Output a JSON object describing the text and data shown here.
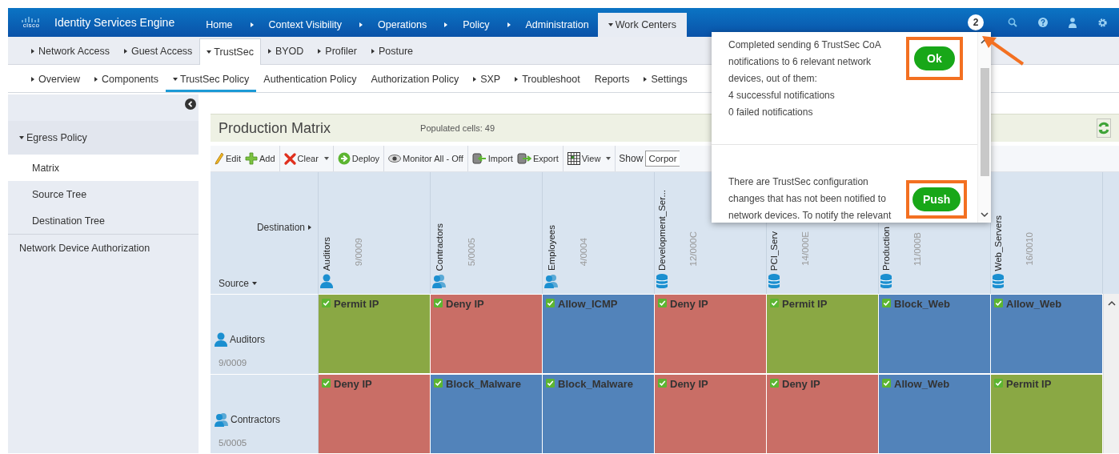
{
  "header": {
    "logo": "cisco",
    "product": "Identity Services Engine",
    "badge": "2",
    "nav": [
      {
        "label": "Home",
        "has_menu": false,
        "selected": false
      },
      {
        "label": "Context Visibility",
        "has_menu": true,
        "selected": false
      },
      {
        "label": "Operations",
        "has_menu": true,
        "selected": false
      },
      {
        "label": "Policy",
        "has_menu": true,
        "selected": false
      },
      {
        "label": "Administration",
        "has_menu": true,
        "selected": false
      },
      {
        "label": "Work Centers",
        "has_menu": true,
        "selected": true
      }
    ]
  },
  "subnav": [
    {
      "label": "Network Access",
      "has_menu": true,
      "selected": false
    },
    {
      "label": "Guest Access",
      "has_menu": true,
      "selected": false
    },
    {
      "label": "TrustSec",
      "has_menu": true,
      "selected": true
    },
    {
      "label": "BYOD",
      "has_menu": true,
      "selected": false
    },
    {
      "label": "Profiler",
      "has_menu": true,
      "selected": false
    },
    {
      "label": "Posture",
      "has_menu": true,
      "selected": false
    }
  ],
  "tabs": [
    {
      "label": "Overview",
      "has_menu": true,
      "selected": false
    },
    {
      "label": "Components",
      "has_menu": true,
      "selected": false
    },
    {
      "label": "TrustSec Policy",
      "has_menu": true,
      "selected": true
    },
    {
      "label": "Authentication Policy",
      "has_menu": false,
      "selected": false
    },
    {
      "label": "Authorization Policy",
      "has_menu": false,
      "selected": false
    },
    {
      "label": "SXP",
      "has_menu": true,
      "selected": false
    },
    {
      "label": "Troubleshoot",
      "has_menu": true,
      "selected": false
    },
    {
      "label": "Reports",
      "has_menu": false,
      "selected": false
    },
    {
      "label": "Settings",
      "has_menu": true,
      "selected": false
    }
  ],
  "sidebar": {
    "section": "Egress Policy",
    "expanded": true,
    "items": [
      {
        "label": "Matrix",
        "selected": true
      },
      {
        "label": "Source Tree",
        "selected": false
      },
      {
        "label": "Destination Tree",
        "selected": false
      }
    ],
    "other_items": [
      {
        "label": "Network Device Authorization",
        "selected": false
      }
    ]
  },
  "matrix": {
    "title": "Production Matrix",
    "populated": "Populated cells: 49",
    "toolbar": [
      [
        {
          "label": "Edit",
          "kind": "edit",
          "dropdown": false
        },
        {
          "label": "Add",
          "kind": "add",
          "dropdown": false
        }
      ],
      [
        {
          "label": "Clear",
          "kind": "clear",
          "dropdown": true
        }
      ],
      [
        {
          "label": "Deploy",
          "kind": "deploy",
          "dropdown": false
        }
      ],
      [
        {
          "label": "Monitor All - Off",
          "kind": "monitor",
          "dropdown": false
        }
      ],
      [
        {
          "label": "Import",
          "kind": "import",
          "dropdown": false
        },
        {
          "label": "Export",
          "kind": "export",
          "dropdown": false
        }
      ],
      [
        {
          "label": "View",
          "kind": "view",
          "dropdown": true
        }
      ]
    ],
    "show_label": "Show",
    "show_value": "Corpor",
    "destination_label": "Destination",
    "source_label": "Source",
    "columns": [
      {
        "name": "Auditors",
        "code": "9/0009",
        "kind": "user"
      },
      {
        "name": "Contractors",
        "code": "5/0005",
        "kind": "group"
      },
      {
        "name": "Employees",
        "code": "4/0004",
        "kind": "group"
      },
      {
        "name": "Development_Ser...",
        "code": "12/000C",
        "kind": "server"
      },
      {
        "name": "PCI_Serv",
        "code": "14/000E",
        "kind": "server"
      },
      {
        "name": "Production",
        "code": "11/000B",
        "kind": "server"
      },
      {
        "name": "Web_Servers",
        "code": "16/0010",
        "kind": "server"
      }
    ],
    "rows": [
      {
        "name": "Auditors",
        "code": "9/0009",
        "kind": "user",
        "cells": [
          {
            "label": "Permit IP",
            "color": "#8aa844",
            "enabled": true
          },
          {
            "label": "Deny IP",
            "color": "#c96e66",
            "enabled": true
          },
          {
            "label": "Allow_ICMP",
            "color": "#5283ba",
            "enabled": true
          },
          {
            "label": "Deny IP",
            "color": "#c96e66",
            "enabled": true
          },
          {
            "label": "Permit IP",
            "color": "#8aa844",
            "enabled": true
          },
          {
            "label": "Block_Web",
            "color": "#5283ba",
            "enabled": true
          },
          {
            "label": "Allow_Web",
            "color": "#5283ba",
            "enabled": true
          }
        ]
      },
      {
        "name": "Contractors",
        "code": "5/0005",
        "kind": "group",
        "cells": [
          {
            "label": "Deny IP",
            "color": "#c96e66",
            "enabled": true
          },
          {
            "label": "Block_Malware",
            "color": "#5283ba",
            "enabled": true
          },
          {
            "label": "Block_Malware",
            "color": "#5283ba",
            "enabled": true
          },
          {
            "label": "Deny IP",
            "color": "#c96e66",
            "enabled": true
          },
          {
            "label": "Deny IP",
            "color": "#c96e66",
            "enabled": true
          },
          {
            "label": "Allow_Web",
            "color": "#5283ba",
            "enabled": true
          },
          {
            "label": "Permit IP",
            "color": "#8aa844",
            "enabled": true
          }
        ]
      }
    ]
  },
  "popup": {
    "messages": [
      {
        "lines": [
          "Completed sending 6 TrustSec CoA",
          "notifications to 6 relevant network",
          "devices, out of them:",
          "4 successful notifications",
          "0 failed notifications"
        ],
        "button": "Ok",
        "highlighted": true
      },
      {
        "lines": [
          "There are TrustSec configuration",
          "changes that has not been notified to",
          "network devices. To notify the relevant"
        ],
        "button": "Push",
        "highlighted": true
      }
    ]
  }
}
